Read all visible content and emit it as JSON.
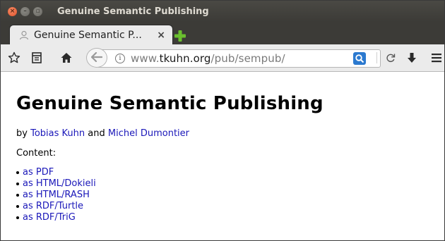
{
  "window": {
    "title": "Genuine Semantic Publishing",
    "buttons": [
      "close",
      "minimize",
      "maximize"
    ]
  },
  "tab": {
    "title": "Genuine Semantic P...",
    "icon": "page-icon",
    "close": "×",
    "new_tab_icon": "plus-icon"
  },
  "toolbar": {
    "icons": [
      "bookmark-star-icon",
      "reading-list-icon",
      "home-icon",
      "back-arrow-icon",
      "info-icon",
      "search-icon",
      "reload-icon",
      "download-icon",
      "menu-icon"
    ]
  },
  "address": {
    "prefix": "www.",
    "host": "tkuhn.org",
    "path": "/pub/sempub/"
  },
  "page": {
    "heading": "Genuine Semantic Publishing",
    "by": "by",
    "author1": "Tobias Kuhn",
    "and": "and",
    "author2": "Michel Dumontier",
    "content_label": "Content:",
    "links": [
      "as PDF",
      "as HTML/Dokieli",
      "as HTML/RASH",
      "as RDF/Turtle",
      "as RDF/TriG"
    ]
  },
  "colors": {
    "link": "#1a17b9",
    "titlebar": "#3c3b37",
    "close_button": "#e1522c",
    "new_tab": "#6abf2e",
    "search_button": "#2b79cf"
  }
}
